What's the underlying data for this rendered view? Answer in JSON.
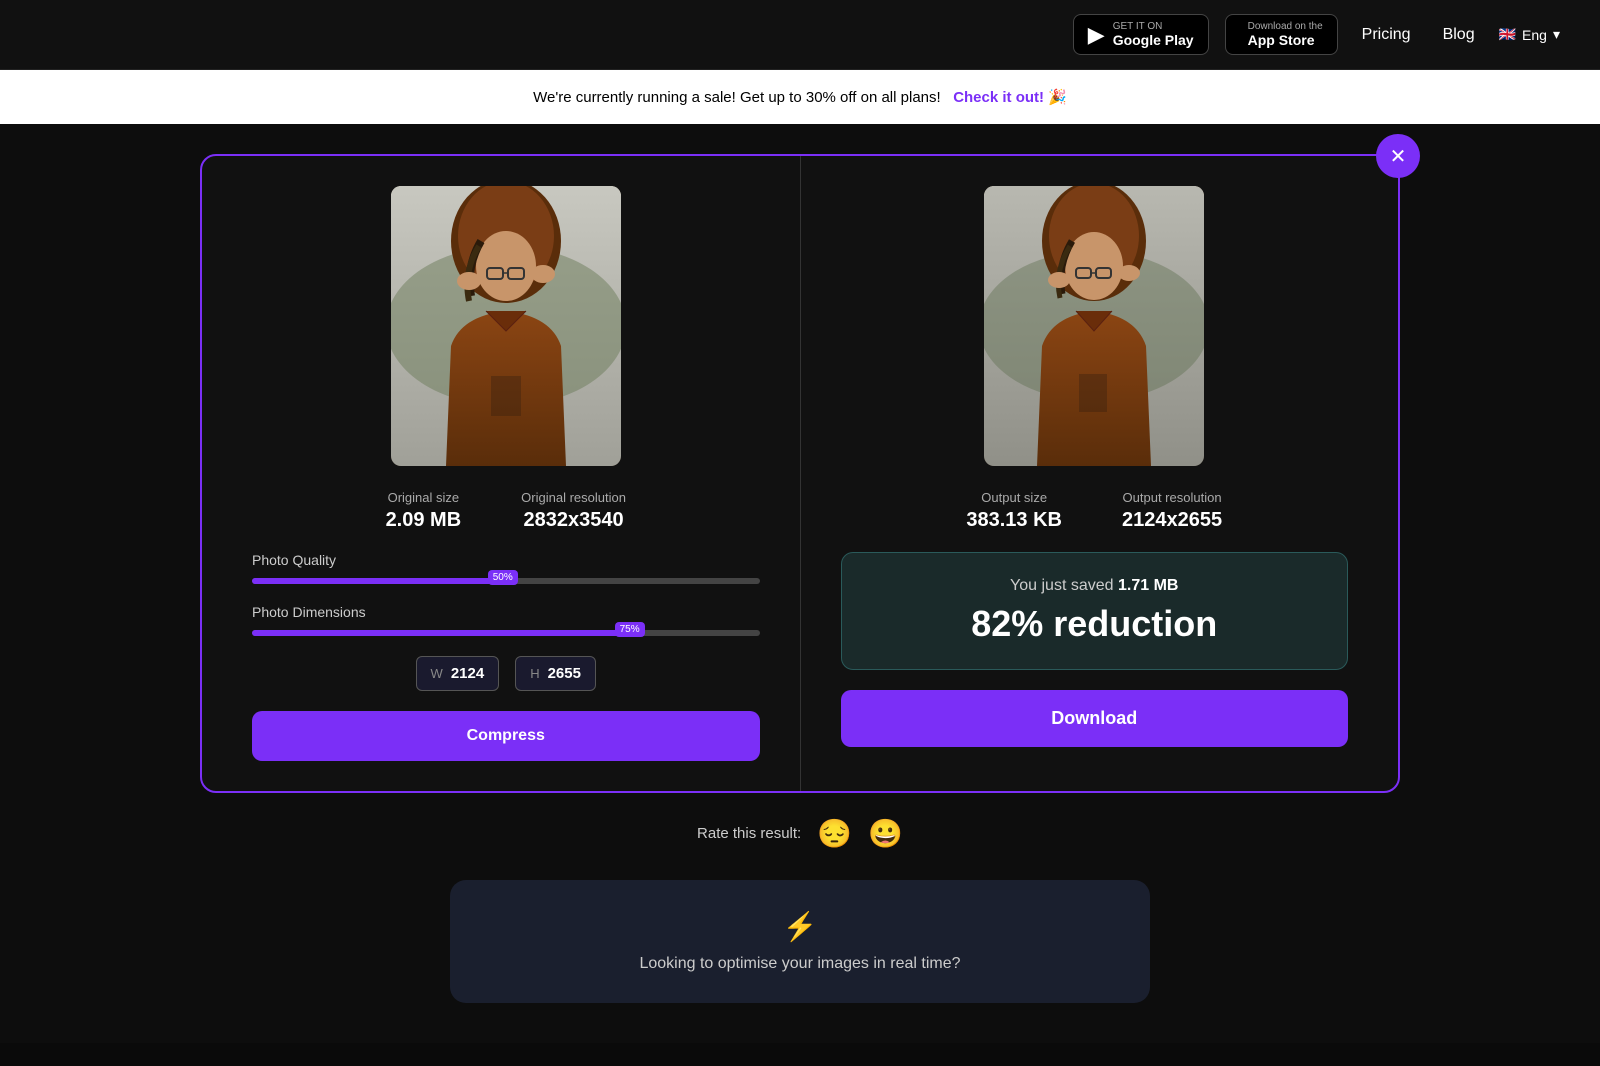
{
  "nav": {
    "google_play_sub": "GET IT ON",
    "google_play_name": "Google Play",
    "app_store_sub": "Download on the",
    "app_store_name": "App Store",
    "pricing_label": "Pricing",
    "blog_label": "Blog",
    "lang_label": "Eng"
  },
  "sale_banner": {
    "text": "We're currently running a sale! Get up to 30% off on all plans!",
    "link_text": "Check it out! 🎉"
  },
  "left_panel": {
    "original_size_label": "Original size",
    "original_size_value": "2.09 MB",
    "original_resolution_label": "Original resolution",
    "original_resolution_value": "2832x3540",
    "quality_label": "Photo Quality",
    "quality_percent": "50%",
    "dimensions_label": "Photo Dimensions",
    "dimensions_percent": "75%",
    "width_label": "W",
    "width_value": "2124",
    "height_label": "H",
    "height_value": "2655",
    "compress_btn": "Compress"
  },
  "right_panel": {
    "output_size_label": "Output size",
    "output_size_value": "383.13 KB",
    "output_resolution_label": "Output resolution",
    "output_resolution_value": "2124x2655",
    "savings_text": "You just saved",
    "savings_amount": "1.71 MB",
    "savings_percent": "82% reduction",
    "download_btn": "Download"
  },
  "rating": {
    "label": "Rate this result:",
    "sad_emoji": "😔",
    "happy_emoji": "😀"
  },
  "promo": {
    "icon": "⚡",
    "text": "Looking to optimise your images in real time?"
  }
}
